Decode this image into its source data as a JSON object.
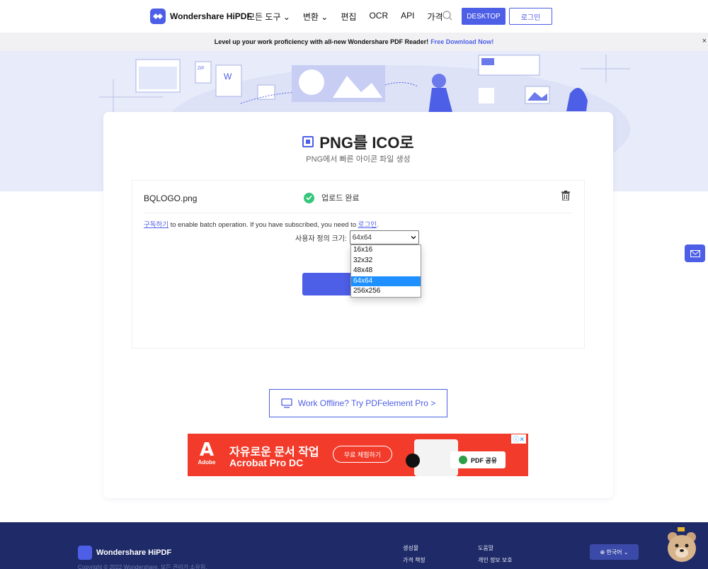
{
  "header": {
    "brand": "Wondershare HiPDF",
    "nav": [
      "모든 도구 ⌄",
      "변환 ⌄",
      "편집",
      "OCR",
      "API",
      "가격"
    ],
    "desktop_btn": "DESKTOP",
    "login_btn": "로그인"
  },
  "promo": {
    "text": "Level up your work proficiency with all-new Wondershare PDF Reader!",
    "link": "Free Download Now!",
    "close": "×"
  },
  "tool": {
    "title": "PNG를 ICO로",
    "subtitle": "PNG에서 빠른 아이콘 파일 생성"
  },
  "file": {
    "name": "BQLOGO.png",
    "status": "업로드 완료"
  },
  "batch": {
    "subscribe_link": "구독하기",
    "text": " to enable batch operation. If you have subscribed, you need to ",
    "login_link": "로그인",
    "end": "."
  },
  "size": {
    "label": "사용자 정의 크기:",
    "selected": "64x64",
    "options": [
      "16x16",
      "32x32",
      "48x48",
      "64x64",
      "256x256"
    ]
  },
  "offline": {
    "label": "Work Offline? Try PDFelement Pro >"
  },
  "ad": {
    "brand": "Adobe",
    "headline": "자유로운 문서 작업",
    "product": "Acrobat Pro DC",
    "cta": "무료 체험하기",
    "share": "PDF 공유"
  },
  "footer": {
    "brand": "Wondershare HiPDF",
    "copyright": "Copyright © 2022 Wondershare. 모든 권리가 소유됨.",
    "col1": [
      "생성물",
      "가격 책정"
    ],
    "col2": [
      "도움말",
      "개인 정보 보호"
    ],
    "language": "한국어 ⌄"
  },
  "colors": {
    "accent": "#4e5fe7",
    "hero": "#e8ebf9",
    "footer": "#1f2b68",
    "ad": "#f23b2a",
    "check": "#34c77b"
  }
}
